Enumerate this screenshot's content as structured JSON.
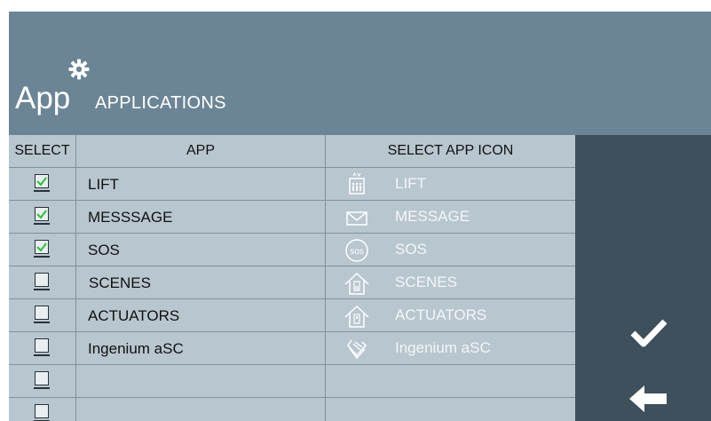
{
  "header": {
    "app_word": "App",
    "subtitle": "APPLICATIONS",
    "icon": "gear-icon"
  },
  "table": {
    "columns": {
      "select": "SELECT",
      "app": "APP",
      "icon": "SELECT APP ICON"
    },
    "rows": [
      {
        "checked": true,
        "app": "LIFT",
        "icon_name": "lift-icon",
        "icon_label": "LIFT"
      },
      {
        "checked": true,
        "app": "MESSSAGE",
        "icon_name": "envelope-icon",
        "icon_label": "MESSAGE"
      },
      {
        "checked": true,
        "app": "SOS",
        "icon_name": "sos-icon",
        "icon_label": "SOS"
      },
      {
        "checked": false,
        "app": "SCENES",
        "icon_name": "home-scene-icon",
        "icon_label": "SCENES"
      },
      {
        "checked": false,
        "app": "ACTUATORS",
        "icon_name": "home-switch-icon",
        "icon_label": "ACTUATORS"
      },
      {
        "checked": false,
        "app": "Ingenium aSC",
        "icon_name": "ingenium-icon",
        "icon_label": "Ingenium aSC"
      },
      {
        "checked": false,
        "app": "",
        "icon_name": "",
        "icon_label": ""
      },
      {
        "checked": false,
        "app": "",
        "icon_name": "",
        "icon_label": ""
      }
    ]
  },
  "side": {
    "confirm_icon": "checkmark-icon",
    "back_icon": "back-arrow-icon"
  },
  "colors": {
    "header_bg": "#6c8596",
    "table_bg": "#b8c6cf",
    "side_bg": "#3e505c",
    "check_green": "#2fbf3a"
  }
}
